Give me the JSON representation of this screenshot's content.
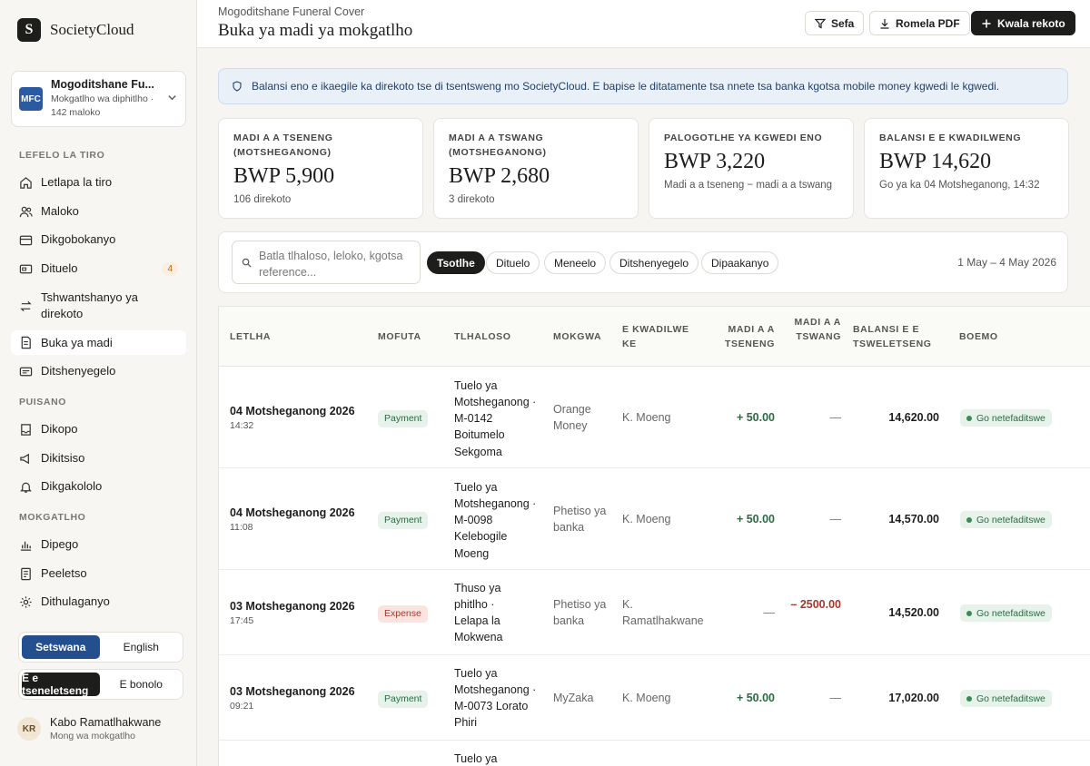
{
  "brand": {
    "logo": "S",
    "name": "SocietyCloud"
  },
  "org": {
    "badge": "MFC",
    "name": "Mogoditshane Fu...",
    "sub": "Mokgatlho wa diphitlho · 142 maloko"
  },
  "nav": {
    "section1": "LEFELO LA TIRO",
    "section2": "PUISANO",
    "section3": "MOKGATLHO",
    "items": [
      {
        "label": "Letlapa la tiro",
        "icon": "home-icon"
      },
      {
        "label": "Maloko",
        "icon": "users-icon"
      },
      {
        "label": "Dikgobokanyo",
        "icon": "wallet-icon"
      },
      {
        "label": "Dituelo",
        "icon": "card-icon",
        "badge": "4"
      },
      {
        "label": "Tshwantshanyo ya direkoto",
        "icon": "reconcile-icon"
      },
      {
        "label": "Buka ya madi",
        "icon": "ledger-icon"
      },
      {
        "label": "Ditshenyegelo",
        "icon": "receipt-icon"
      },
      {
        "label": "Dikopo",
        "icon": "inbox-icon"
      },
      {
        "label": "Dikitsiso",
        "icon": "megaphone-icon"
      },
      {
        "label": "Dikgakololo",
        "icon": "bell-icon"
      },
      {
        "label": "Dipego",
        "icon": "chart-icon"
      },
      {
        "label": "Peeletso",
        "icon": "document-icon"
      },
      {
        "label": "Dithulaganyo",
        "icon": "gear-icon"
      }
    ]
  },
  "lang": {
    "a": "Setswana",
    "b": "English"
  },
  "mode": {
    "a": "E e tseneletseng",
    "b": "E bonolo"
  },
  "user": {
    "initials": "KR",
    "name": "Kabo Ramatlhakwane",
    "role": "Mong wa mokgatlho"
  },
  "header": {
    "crumb": "Mogoditshane Funeral Cover",
    "title": "Buka ya madi ya mokgatlho",
    "filter": "Sefa",
    "export": "Romela PDF",
    "add": "Kwala rekoto"
  },
  "banner": "Balansi eno e ikaegile ka direkoto tse di tsentsweng mo SocietyCloud. E bapise le ditatamente tsa nnete tsa banka kgotsa mobile money kgwedi le kgwedi.",
  "cards": [
    {
      "label": "MADI A A TSENENG (MOTSHEGANONG)",
      "value": "BWP 5,900",
      "sub": "106 direkoto"
    },
    {
      "label": "MADI A A TSWANG (MOTSHEGANONG)",
      "value": "BWP 2,680",
      "sub": "3 direkoto"
    },
    {
      "label": "PALOGOTLHE YA KGWEDI ENO",
      "value": "BWP 3,220",
      "sub": "Madi a a tseneng − madi a a tswang"
    },
    {
      "label": "BALANSI E E KWADILWENG",
      "value": "BWP 14,620",
      "sub": "Go ya ka 04 Motsheganong, 14:32"
    }
  ],
  "filters": {
    "search_placeholder": "Batla tlhaloso, leloko, kgotsa reference...",
    "chips": [
      "Tsotlhe",
      "Dituelo",
      "Meneelo",
      "Ditshenyegelo",
      "Dipaakanyo"
    ],
    "date_range": "1 May – 4 May 2026"
  },
  "table": {
    "headers": [
      "LETLHA",
      "MOFUTA",
      "TLHALOSO",
      "MOKGWA",
      "E KWADILWE KE",
      "MADI A A TSENENG",
      "MADI A A TSWANG",
      "BALANSI E E TSWELETSENG",
      "BOEMO"
    ],
    "rows": [
      {
        "date": "04 Motsheganong 2026",
        "time": "14:32",
        "type": "Payment",
        "desc": "Tuelo ya Motsheganong · M-0142 Boitumelo Sekgoma",
        "method": "Orange Money",
        "by": "K. Moeng",
        "in": "+ 50.00",
        "out": "—",
        "balance": "14,620.00",
        "status": "Go netefaditswe"
      },
      {
        "date": "04 Motsheganong 2026",
        "time": "11:08",
        "type": "Payment",
        "desc": "Tuelo ya Motsheganong · M-0098 Kelebogile Moeng",
        "method": "Phetiso ya banka",
        "by": "K. Moeng",
        "in": "+ 50.00",
        "out": "—",
        "balance": "14,570.00",
        "status": "Go netefaditswe"
      },
      {
        "date": "03 Motsheganong 2026",
        "time": "17:45",
        "type": "Expense",
        "desc": "Thuso ya phitlho · Lelapa la Mokwena",
        "method": "Phetiso ya banka",
        "by": "K. Ramatlhakwane",
        "in": "—",
        "out": "– 2500.00",
        "balance": "14,520.00",
        "status": "Go netefaditswe"
      },
      {
        "date": "03 Motsheganong 2026",
        "time": "09:21",
        "type": "Payment",
        "desc": "Tuelo ya Motsheganong · M-0073 Lorato Phiri",
        "method": "MyZaka",
        "by": "K. Moeng",
        "in": "+ 50.00",
        "out": "—",
        "balance": "17,020.00",
        "status": "Go netefaditswe"
      },
      {
        "desc": "Tuelo ya"
      }
    ]
  }
}
